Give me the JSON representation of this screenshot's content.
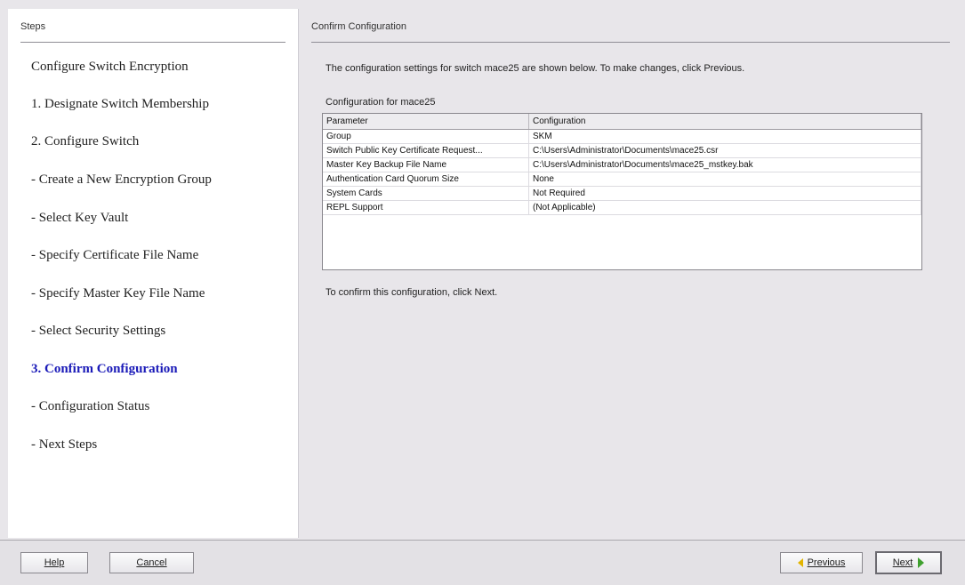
{
  "steps_panel": {
    "header": "Steps",
    "items": [
      {
        "label": "Configure Switch Encryption",
        "active": false
      },
      {
        "label": "1. Designate Switch Membership",
        "active": false
      },
      {
        "label": "2. Configure Switch",
        "active": false
      },
      {
        "label": "- Create a New Encryption Group",
        "active": false
      },
      {
        "label": "- Select Key Vault",
        "active": false
      },
      {
        "label": "- Specify Certificate File Name",
        "active": false
      },
      {
        "label": "- Specify Master Key File Name",
        "active": false
      },
      {
        "label": "- Select Security Settings",
        "active": false
      },
      {
        "label": "3. Confirm Configuration",
        "active": true
      },
      {
        "label": "- Configuration Status",
        "active": false
      },
      {
        "label": "- Next Steps",
        "active": false
      }
    ]
  },
  "main": {
    "header": "Confirm Configuration",
    "intro": "The configuration settings for switch mace25 are shown below. To make changes, click Previous.",
    "config_for": "Configuration for mace25",
    "table": {
      "columns": [
        "Parameter",
        "Configuration"
      ],
      "rows": [
        [
          "Group",
          "SKM"
        ],
        [
          "Switch Public Key Certificate Request...",
          "C:\\Users\\Administrator\\Documents\\mace25.csr"
        ],
        [
          "Master Key Backup File Name",
          "C:\\Users\\Administrator\\Documents\\mace25_mstkey.bak"
        ],
        [
          "Authentication Card Quorum Size",
          "None"
        ],
        [
          "System Cards",
          "Not Required"
        ],
        [
          "REPL Support",
          "(Not Applicable)"
        ]
      ]
    },
    "confirm_note": "To confirm this configuration, click Next."
  },
  "buttons": {
    "help": "Help",
    "cancel": "Cancel",
    "previous": "Previous",
    "next": "Next"
  },
  "colors": {
    "active_step": "#1a1ab8",
    "previous_arrow": "#e2b400",
    "next_arrow": "#3fa02f"
  }
}
